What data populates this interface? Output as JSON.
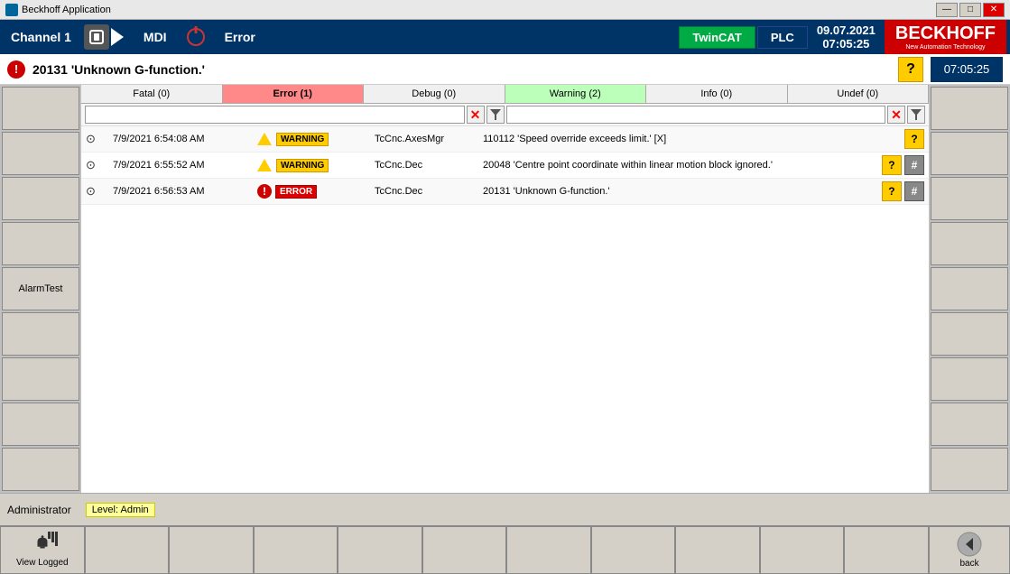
{
  "titleBar": {
    "title": "Beckhoff Application",
    "controls": {
      "minimize": "—",
      "maximize": "□",
      "close": "✕"
    }
  },
  "header": {
    "channel": "Channel  1",
    "mode": "MDI",
    "status": "Error",
    "twincat": "TwinCAT",
    "plc": "PLC",
    "date": "09.07.2021",
    "time": "07:05:25",
    "brand": "BECKHOFF",
    "brandSub": "New Automation Technology"
  },
  "alert": {
    "message": "20131 'Unknown G-function.'",
    "helpLabel": "?"
  },
  "tabs": [
    {
      "label": "Fatal (0)",
      "state": "normal"
    },
    {
      "label": "Error (1)",
      "state": "error"
    },
    {
      "label": "Debug (0)",
      "state": "normal"
    },
    {
      "label": "Warning (2)",
      "state": "warning"
    },
    {
      "label": "Info (0)",
      "state": "normal"
    },
    {
      "label": "Undef (0)",
      "state": "normal"
    }
  ],
  "logEntries": [
    {
      "expand": "⊙",
      "timestamp": "7/9/2021 6:54:08 AM",
      "level": "WARNING",
      "source": "TcCnc.AxesMgr",
      "message": "110112 'Speed override exceeds limit.' [X]",
      "hasHelp": true,
      "hasHash": false
    },
    {
      "expand": "⊙",
      "timestamp": "7/9/2021 6:55:52 AM",
      "level": "WARNING",
      "source": "TcCnc.Dec",
      "message": "20048 'Centre point coordinate within linear motion block ignored.'",
      "hasHelp": true,
      "hasHash": true
    },
    {
      "expand": "⊙",
      "timestamp": "7/9/2021 6:56:53 AM",
      "level": "ERROR",
      "source": "TcCnc.Dec",
      "message": "20131 'Unknown G-function.'",
      "hasHelp": true,
      "hasHash": true
    }
  ],
  "statusBar": {
    "user": "Administrator",
    "levelLabel": "Level: Admin"
  },
  "bottomToolbar": {
    "buttons": [
      {
        "label": "View Logged",
        "hasIcon": true
      },
      {
        "label": ""
      },
      {
        "label": ""
      },
      {
        "label": ""
      },
      {
        "label": ""
      },
      {
        "label": ""
      },
      {
        "label": ""
      },
      {
        "label": ""
      },
      {
        "label": ""
      },
      {
        "label": ""
      },
      {
        "label": ""
      }
    ],
    "backLabel": "back"
  },
  "sideButtons": {
    "left": [
      "",
      "",
      "",
      "",
      "AlarmTest",
      "",
      "",
      "",
      ""
    ],
    "right": [
      "",
      "",
      "",
      "",
      "",
      "",
      "",
      "",
      ""
    ]
  },
  "filterPlaceholder": ""
}
